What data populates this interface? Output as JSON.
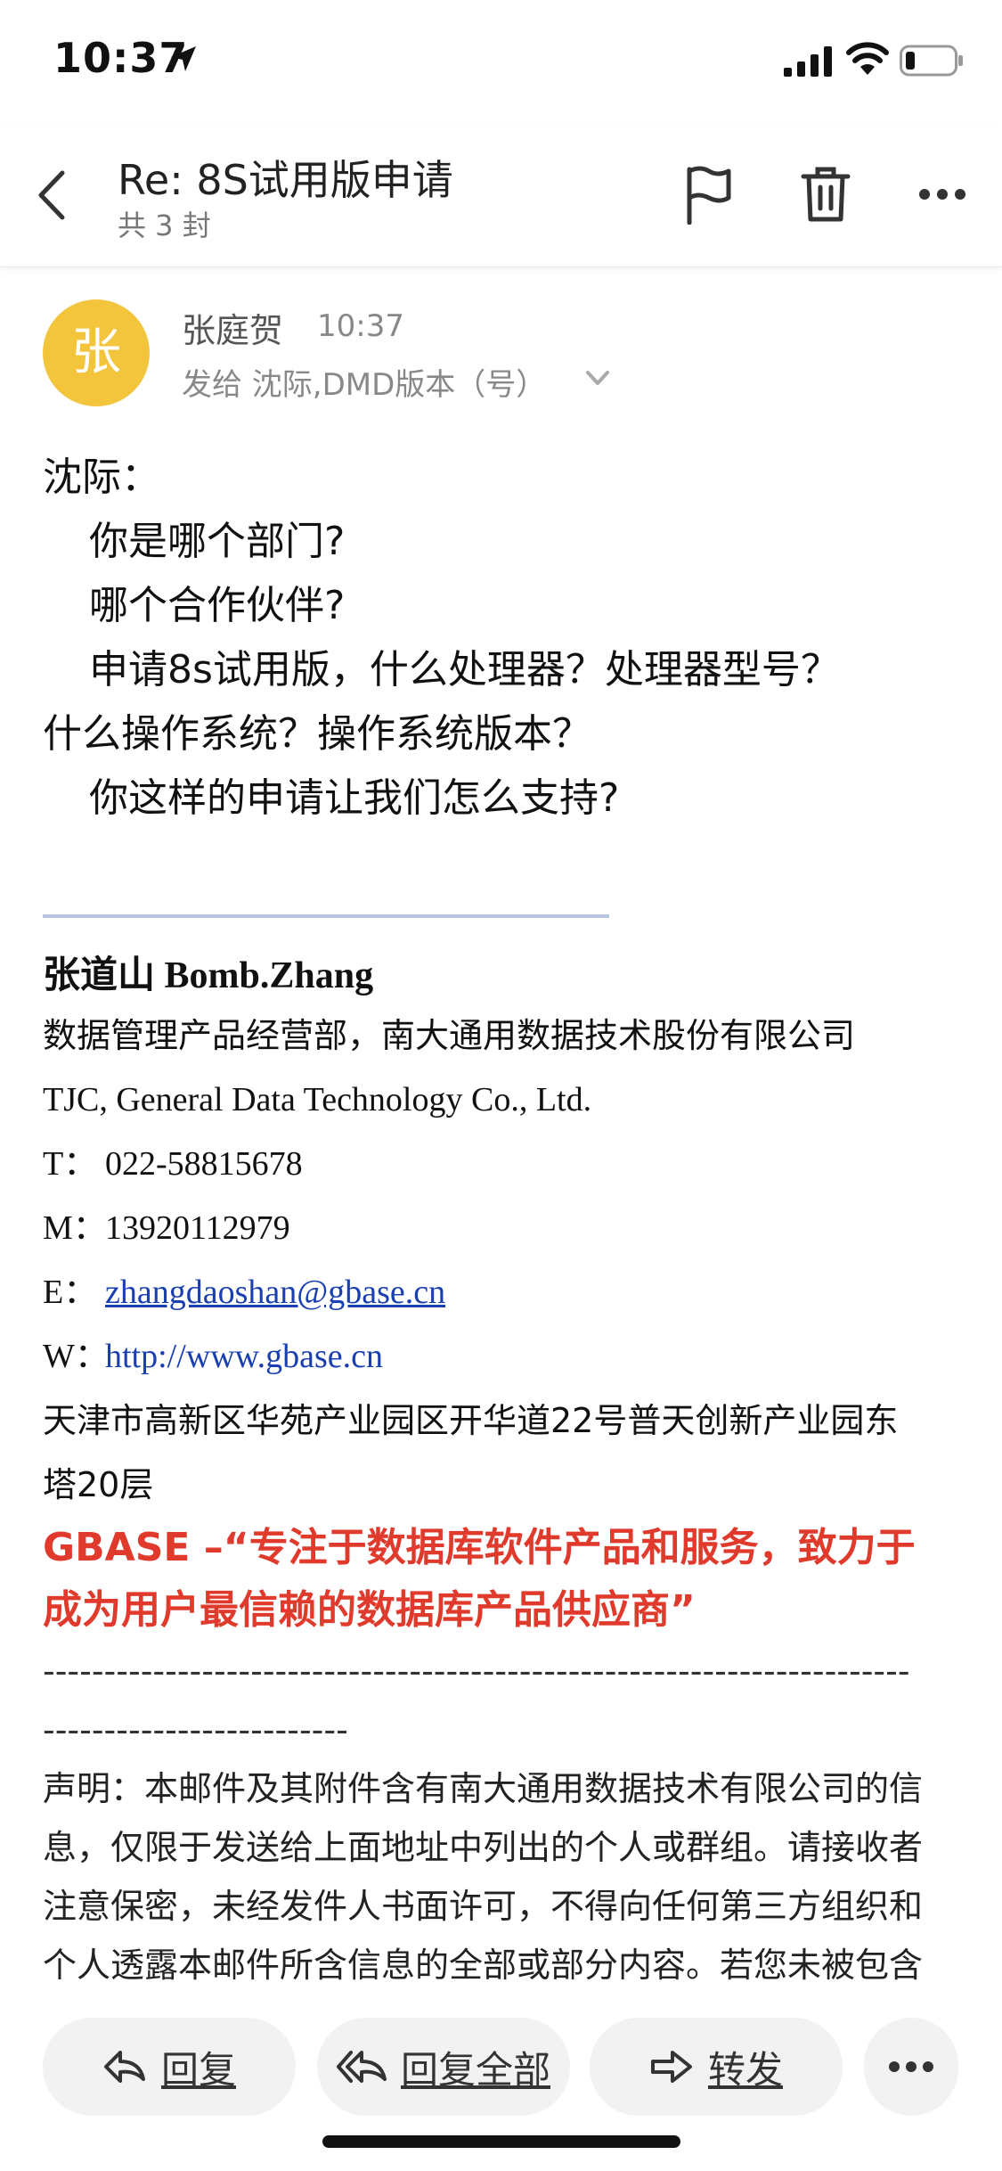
{
  "status_bar": {
    "time": "10:37"
  },
  "header": {
    "title": "Re: 8S试用版申请",
    "subtitle": "共 3 封"
  },
  "sender": {
    "avatar_letter": "张",
    "avatar_color": "#f2c53d",
    "name": "张庭贺",
    "time": "10:37",
    "to": "发给 沈际,DMD版本（号）"
  },
  "body": {
    "lines": [
      "沈际：",
      "你是哪个部门?",
      "哪个合作伙伴?",
      "申请8s试用版，什么处理器？处理器型号？",
      "什么操作系统？操作系统版本？",
      "你这样的申请让我们怎么支持?"
    ]
  },
  "signature": {
    "name": "张道山 Bomb.Zhang",
    "dept": "数据管理产品经营部，南大通用数据技术股份有限公司",
    "company_en": "TJC, General Data Technology Co., Ltd.",
    "t_label": "T：",
    "t_value": "022-58815678",
    "m_label": "M：",
    "m_value": "13920112979",
    "e_label": "E：",
    "e_value": "zhangdaoshan@gbase.cn",
    "w_label": "W：",
    "w_value": "http://www.gbase.cn",
    "address_1": "天津市高新区华苑产业园区开华道22号普天创新产业园东",
    "address_2": "塔20层",
    "slogan_1": "GBASE –“专注于数据库软件产品和服务，致力于",
    "slogan_2": "成为用户最信赖的数据库产品供应商”",
    "slogan_color": "#e03a2c",
    "dashes_1": "-----------------------------------------------------------------------",
    "dashes_2": "-------------------------",
    "disclaimer": [
      "声明：本邮件及其附件含有南大通用数据技术有限公司的信",
      "息，仅限于发送给上面地址中列出的个人或群组。请接收者",
      "注意保密，未经发件人书面许可，不得向任何第三方组织和",
      "个人透露本邮件所含信息的全部或部分内容。若您未被包含"
    ]
  },
  "actions": {
    "reply": "回复",
    "reply_all": "回复全部",
    "forward": "转发"
  }
}
